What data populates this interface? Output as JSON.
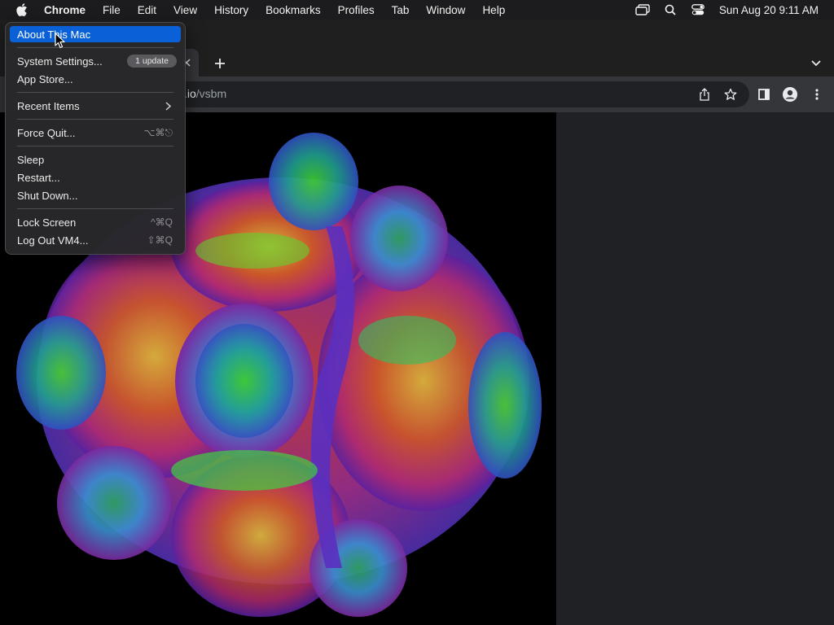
{
  "menubar": {
    "app": "Chrome",
    "items": [
      "File",
      "Edit",
      "View",
      "History",
      "Bookmarks",
      "Profiles",
      "Tab",
      "Window",
      "Help"
    ],
    "clock": "Sun Aug 20  9:11 AM",
    "icons": [
      "screen-mirroring-icon",
      "search-icon",
      "control-center-icon"
    ]
  },
  "browser": {
    "url_main": ".io",
    "url_path": "/vsbm"
  },
  "apple_menu": {
    "about": "About This Mac",
    "settings": "System Settings...",
    "settings_badge": "1 update",
    "app_store": "App Store...",
    "recent_items": "Recent Items",
    "force_quit": "Force Quit...",
    "force_quit_shortcut": "⌥⌘⎋",
    "sleep": "Sleep",
    "restart": "Restart...",
    "shut_down": "Shut Down...",
    "lock_screen": "Lock Screen",
    "lock_screen_shortcut": "^⌘Q",
    "log_out": "Log Out VM4...",
    "log_out_shortcut": "⇧⌘Q"
  },
  "colors": {
    "highlight": "#0a60d6",
    "menubar": "#1c1c1e",
    "toolbar": "#35363a"
  }
}
